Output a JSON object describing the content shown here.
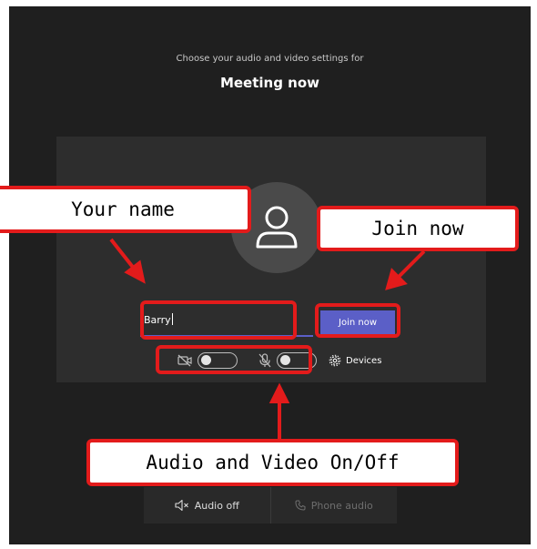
{
  "header": {
    "subtitle": "Choose your audio and video settings for",
    "title": "Meeting now"
  },
  "prejoin": {
    "name_value": "Barry",
    "join_label": "Join now",
    "devices_label": "Devices"
  },
  "bottom": {
    "audio_off_label": "Audio off",
    "phone_audio_label": "Phone audio"
  },
  "annotations": {
    "your_name": "Your name",
    "join_now": "Join now",
    "audio_video": "Audio and Video On/Off"
  },
  "colors": {
    "background": "#1f1f1f",
    "panel": "#2d2d2d",
    "accent": "#5b5fc7",
    "annotation": "#e31b1b"
  },
  "icons": [
    "person-icon",
    "camera-off-icon",
    "mic-off-icon",
    "gear-icon",
    "speaker-off-icon",
    "phone-icon"
  ]
}
